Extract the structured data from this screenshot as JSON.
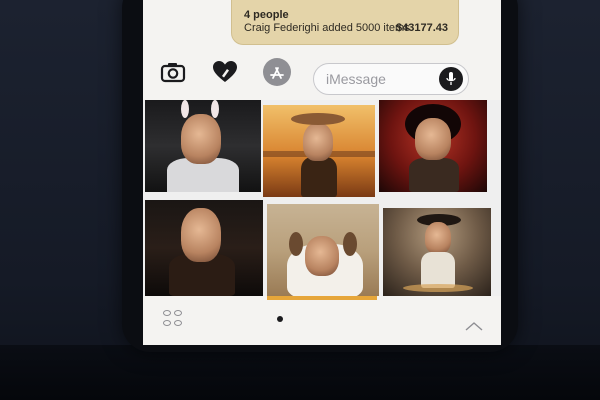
{
  "message_bubble": {
    "people": "4 people",
    "amount": "$43177.43",
    "detail": "Craig Federighi added 5000 items",
    "color": "#e4d4a9"
  },
  "toolbar": {
    "camera_icon": "camera-icon",
    "digital_touch_icon": "heart-hand-icon",
    "app_store_icon": "app-store-icon",
    "input_placeholder": "iMessage",
    "mic_icon": "microphone-icon"
  },
  "sticker_grid": {
    "stickers": [
      {
        "name": "bunny-ears-sticker"
      },
      {
        "name": "cowboy-sticker"
      },
      {
        "name": "red-background-sticker"
      },
      {
        "name": "dark-portrait-sticker"
      },
      {
        "name": "dog-sticker"
      },
      {
        "name": "adventurer-sticker"
      }
    ]
  },
  "bottom_bar": {
    "drawer_icon": "app-drawer-icon",
    "page_indicator_count": 1,
    "expand_icon": "chevron-up-icon"
  }
}
